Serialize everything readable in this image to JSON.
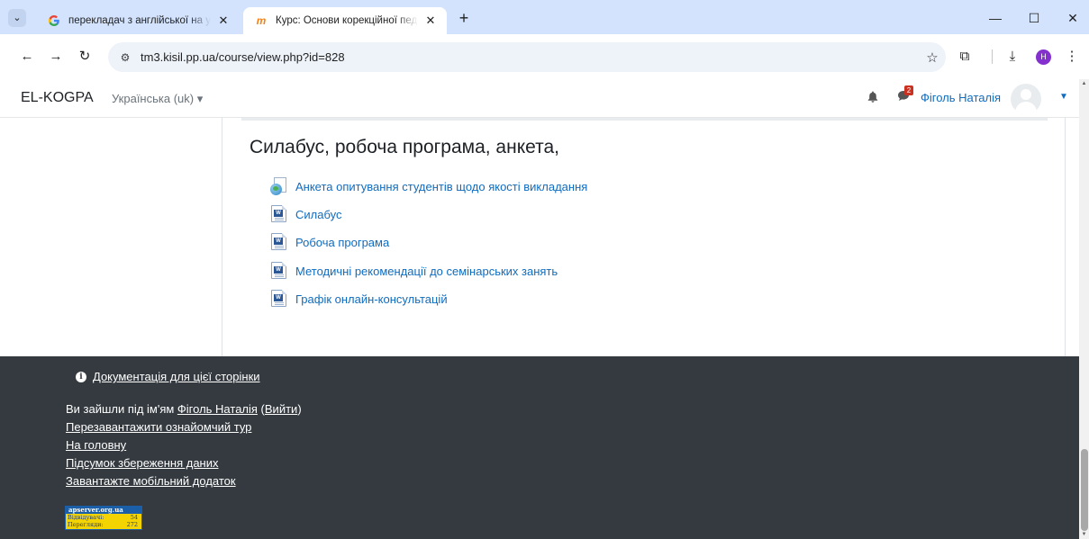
{
  "browser": {
    "tabs": [
      {
        "title": "перекладач з англійської на ук",
        "favicon": "google-icon"
      },
      {
        "title": "Курс: Основи корекційної педа",
        "favicon": "moodle-icon"
      }
    ],
    "tab_menu": "⌄",
    "new_tab": "+",
    "window": {
      "minimize": "—",
      "maximize": "☐",
      "close": "✕"
    },
    "url": "tm3.kisil.pp.ua/course/view.php?id=828",
    "profile_initial": "H"
  },
  "navbar": {
    "brand": "EL-KOGPA",
    "language": "Українська (uk) ▾",
    "notification_count": "2",
    "user_name": "Фіголь Наталія"
  },
  "section": {
    "title": "Силабус, робоча програма, анкета,",
    "activities": [
      {
        "label": "Анкета опитування студентів щодо якості викладання",
        "icon": "survey-icon"
      },
      {
        "label": "Силабус",
        "icon": "word-doc-icon"
      },
      {
        "label": "Робоча програма",
        "icon": "word-doc-icon"
      },
      {
        "label": "Методичні рекомендації до семінарських занять",
        "icon": "word-doc-icon"
      },
      {
        "label": "Графік онлайн-консультацій",
        "icon": "word-doc-icon"
      }
    ]
  },
  "footer": {
    "docs_link": "Документація для цієї сторінки",
    "logged_in_prefix": "Ви зайшли під ім'ям ",
    "logged_in_user": "Фіголь Наталія",
    "logout_open": " (",
    "logout_label": "Вийти",
    "logout_close": ")",
    "links": [
      "Перезавантажити ознайомчий тур",
      "На головну",
      "Підсумок збереження даних",
      "Завантажте мобільний додаток"
    ],
    "counter": {
      "site": "apserver.org.ua",
      "visitors_label": "Відвідувачі:",
      "visitors": "54",
      "views_label": "Перегляди:",
      "views": "272"
    }
  },
  "colors": {
    "link": "#0f6cbf",
    "footer_bg": "#343a40",
    "tabstrip_bg": "#d3e3fd"
  }
}
